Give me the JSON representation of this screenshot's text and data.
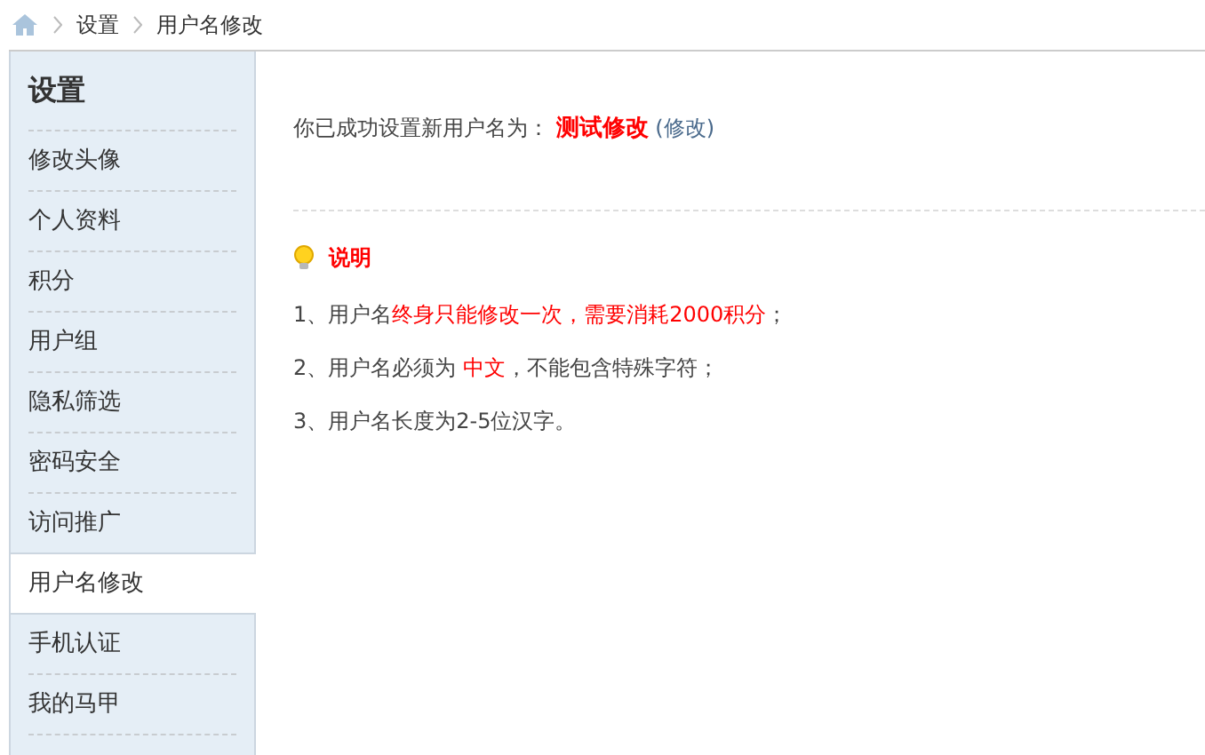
{
  "breadcrumb": [
    "设置",
    "用户名修改"
  ],
  "sidebar": {
    "title": "设置",
    "items": [
      {
        "label": "修改头像",
        "selected": false
      },
      {
        "label": "个人资料",
        "selected": false
      },
      {
        "label": "积分",
        "selected": false
      },
      {
        "label": "用户组",
        "selected": false
      },
      {
        "label": "隐私筛选",
        "selected": false
      },
      {
        "label": "密码安全",
        "selected": false
      },
      {
        "label": "访问推广",
        "selected": false
      },
      {
        "label": "用户名修改",
        "selected": true
      },
      {
        "label": "手机认证",
        "selected": false
      },
      {
        "label": "我的马甲",
        "selected": false
      }
    ]
  },
  "status": {
    "message": "你已成功设置新用户名为：",
    "username": "测试修改",
    "link": "(修改)"
  },
  "notes": {
    "title": "说明",
    "rules": [
      [
        {
          "text": "1、用户名",
          "highlight": false
        },
        {
          "text": "终身只能修改一次，需要消耗2000积分",
          "highlight": true
        },
        {
          "text": "；",
          "highlight": false
        }
      ],
      [
        {
          "text": "2、用户名必须为 ",
          "highlight": false
        },
        {
          "text": "中文",
          "highlight": true
        },
        {
          "text": "，不能包含特殊字符；",
          "highlight": false
        }
      ],
      [
        {
          "text": "3、用户名长度为2-5位汉字。",
          "highlight": false
        }
      ]
    ]
  }
}
